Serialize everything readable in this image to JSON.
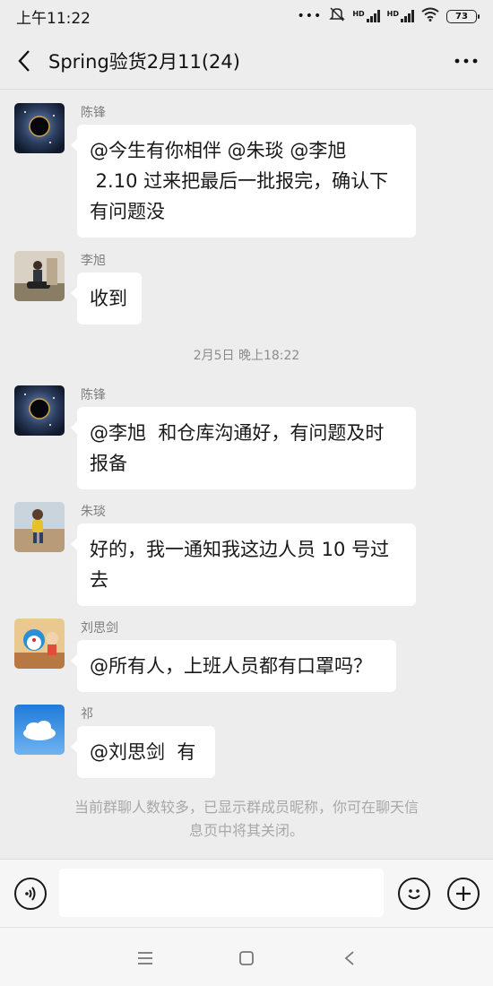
{
  "status": {
    "time": "上午11:22",
    "dots": "•••",
    "hd1": "HD",
    "hd2": "HD",
    "battery": "73"
  },
  "header": {
    "title": "Spring验货2月11(24)"
  },
  "messages": [
    {
      "sender": "陈锋",
      "avatar": "galaxy-avatar",
      "text_lines": [
        "@今生有你相伴  @朱琰  @李旭",
        " 2.10 过来把最后一批报完，确认下",
        "有问题没"
      ]
    },
    {
      "sender": "李旭",
      "avatar": "photo-avatar",
      "text_lines": [
        "收到"
      ]
    },
    {
      "sender": "陈锋",
      "avatar": "galaxy-avatar",
      "text_lines": [
        "@李旭  和仓库沟通好，有问题及时",
        "报备"
      ]
    },
    {
      "sender": "朱琰",
      "avatar": "child-avatar",
      "text_lines": [
        "好的，我一通知我这边人员 10 号过",
        "去"
      ]
    },
    {
      "sender": "刘思剑",
      "avatar": "cartoon-avatar",
      "text_lines": [
        "@所有人，上班人员都有口罩吗？"
      ]
    },
    {
      "sender": "祁",
      "avatar": "sky-avatar",
      "text_lines": [
        "@刘思剑  有"
      ]
    }
  ],
  "timestamp": "2月5日 晚上18:22",
  "notice_lines": [
    "当前群聊人数较多，已显示群成员昵称，你可在聊天信",
    "息页中将其关闭。"
  ],
  "input": {
    "placeholder": ""
  },
  "colors": {
    "background": "#ededed",
    "bubble": "#ffffff",
    "sender": "#7d7d7d"
  }
}
